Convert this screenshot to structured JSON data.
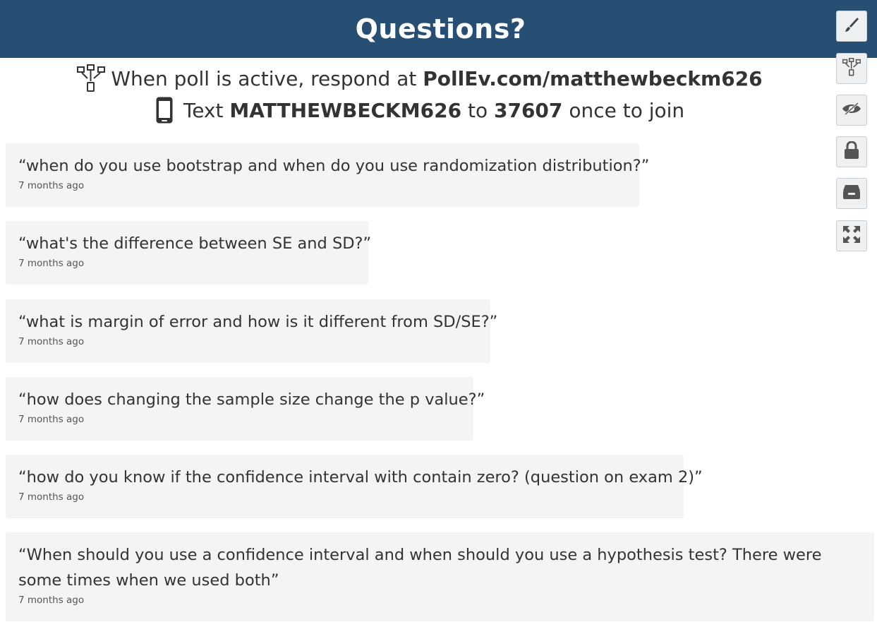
{
  "header": {
    "title": "Questions?"
  },
  "instructions": {
    "line1_prefix": "When poll is active, respond at",
    "line1_url": "PollEv.com/matthewbeckm626",
    "line2_prefix": "Text",
    "line2_code": "MATTHEWBECKM626",
    "line2_mid": "to",
    "line2_number": "37607",
    "line2_suffix": "once to join"
  },
  "questions": [
    {
      "text": "“when do you use bootstrap and when do you use randomization distribution?”",
      "time": "7 months ago"
    },
    {
      "text": "“what's the difference between SE and SD?”",
      "time": "7 months ago"
    },
    {
      "text": "“what is margin of error and how is it different from SD/SE?”",
      "time": "7 months ago"
    },
    {
      "text": "“how does changing the sample size change the p value?”",
      "time": "7 months ago"
    },
    {
      "text": "“how do you know if the confidence interval with contain zero? (question on exam 2)”",
      "time": "7 months ago"
    },
    {
      "text": "“When should you use a confidence interval and when should you use a hypothesis test? There were some times when we used both”",
      "time": "7 months ago"
    }
  ],
  "toolbar": {
    "icons": [
      "brush-icon",
      "activity-icon",
      "eye-slash-icon",
      "lock-icon",
      "archive-icon",
      "fullscreen-icon"
    ]
  },
  "colors": {
    "header_bg": "#274f74",
    "card_bg": "#f4f4f4",
    "text": "#333333"
  }
}
